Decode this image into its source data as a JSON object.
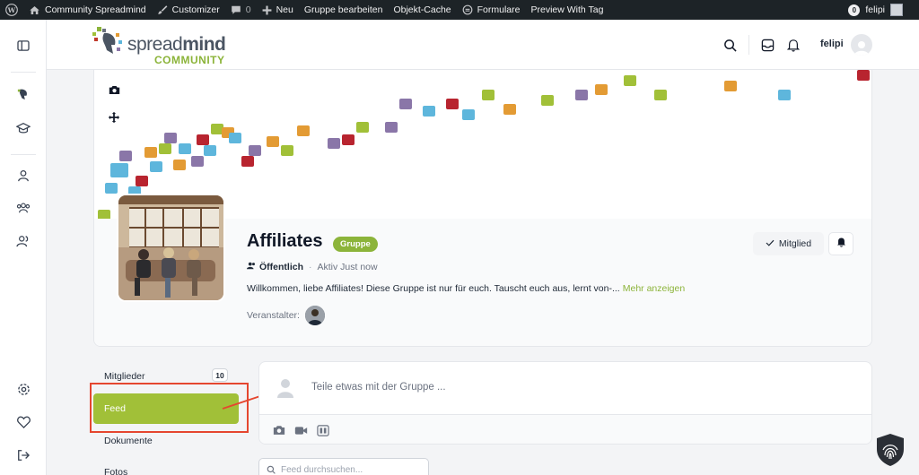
{
  "adminbar": {
    "site_name": "Community Spreadmind",
    "customizer": "Customizer",
    "comments_count": "0",
    "new_label": "Neu",
    "edit_group": "Gruppe bearbeiten",
    "object_cache": "Objekt-Cache",
    "forms": "Formulare",
    "preview": "Preview With Tag",
    "user_badge": "0",
    "user_name": "felipi"
  },
  "header": {
    "logo_text_main": "spread",
    "logo_text_bold": "mind",
    "logo_text_sub": "COMMUNITY",
    "user_name": "felipi"
  },
  "group": {
    "name": "Affiliates",
    "type_badge": "Gruppe",
    "privacy": "Öffentlich",
    "active": "Aktiv Just now",
    "description": "Willkommen, liebe Affiliates! Diese Gruppe ist nur für euch. Tauscht euch aus, lernt von-...",
    "show_more": "Mehr anzeigen",
    "organizer_label": "Veranstalter:",
    "member_button": "Mitglied"
  },
  "group_nav": {
    "items": [
      {
        "label": "Mitglieder",
        "count": "10"
      },
      {
        "label": "Feed"
      },
      {
        "label": "Dokumente"
      },
      {
        "label": "Fotos"
      }
    ]
  },
  "composer": {
    "placeholder": "Teile etwas mit der Gruppe ..."
  },
  "feed_search": {
    "placeholder": "Feed durchsuchen..."
  },
  "colors": {
    "brand_green": "#8cb43a",
    "nav_active": "#a1c038",
    "annotation_red": "#e5462f",
    "adminbar_bg": "#1d2327"
  },
  "icons": [
    "wordpress-icon",
    "home-icon",
    "brush-icon",
    "comment-icon",
    "plus-icon",
    "forms-icon",
    "search-icon",
    "inbox-icon",
    "bell-icon",
    "camera-icon",
    "move-icon",
    "users-icon",
    "check-icon",
    "video-icon",
    "gif-icon",
    "settings-icon",
    "heart-icon",
    "logout-icon",
    "shield-icon"
  ]
}
